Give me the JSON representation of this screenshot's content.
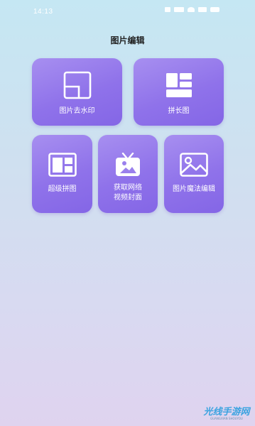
{
  "status_bar": {
    "time": "14:13",
    "icons": [
      "notification-icon",
      "data-icon",
      "signal-icon",
      "wifi-icon",
      "battery-icon"
    ]
  },
  "page": {
    "title": "图片编辑"
  },
  "tiles": [
    {
      "id": "watermark",
      "label": "图片去水印",
      "icon": "remove-watermark-icon"
    },
    {
      "id": "long",
      "label": "拼长图",
      "icon": "long-collage-icon"
    },
    {
      "id": "super",
      "label": "超级拼图",
      "icon": "super-collage-icon"
    },
    {
      "id": "cover",
      "label_line1": "获取网络",
      "label_line2": "视频封面",
      "icon": "video-cover-icon"
    },
    {
      "id": "magic",
      "label": "图片魔法编辑",
      "icon": "image-magic-edit-icon"
    }
  ],
  "watermark_logo": {
    "text": "光线手游网",
    "subtext": "GUANGXIAN SHOUYOU"
  },
  "colors": {
    "tile_gradient_start": "#a78ff0",
    "tile_gradient_end": "#8466e6",
    "background_top": "#c5e7f3",
    "background_bottom": "#dfd3ef"
  }
}
